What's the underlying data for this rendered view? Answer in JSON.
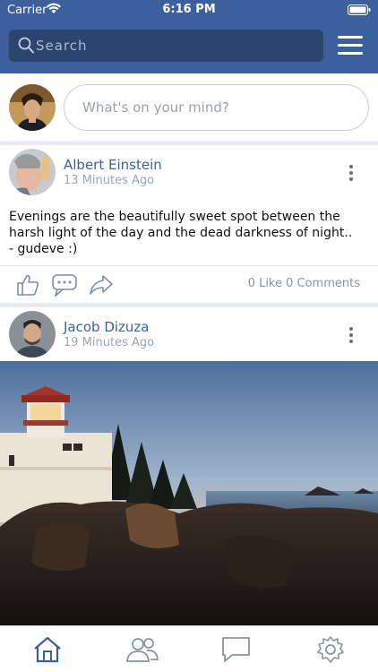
{
  "status_bar": {
    "carrier": "Carrier",
    "time": "6:16 PM"
  },
  "header": {
    "search_placeholder": "Search"
  },
  "composer": {
    "placeholder": "What's on your mind?"
  },
  "posts": [
    {
      "author": "Albert Einstein",
      "ago": "13 Minutes Ago",
      "text_lines": [
        "Evenings are the beautifully sweet spot between the",
        "harsh light of the day and the dead darkness of night..",
        "- gudeve :)"
      ],
      "counts": "0 Like 0 Comments"
    },
    {
      "author": "Jacob Dizuza",
      "ago": "19 Minutes Ago"
    }
  ],
  "colors": {
    "header_bg": "#3d5f9b",
    "search_bg": "#2b456f",
    "accent": "#3d5f9b",
    "tab_inactive": "#8c939c"
  },
  "tabs": [
    {
      "icon": "home-icon",
      "active": true
    },
    {
      "icon": "friends-icon",
      "active": false
    },
    {
      "icon": "chat-icon",
      "active": false
    },
    {
      "icon": "settings-icon",
      "active": false
    }
  ]
}
